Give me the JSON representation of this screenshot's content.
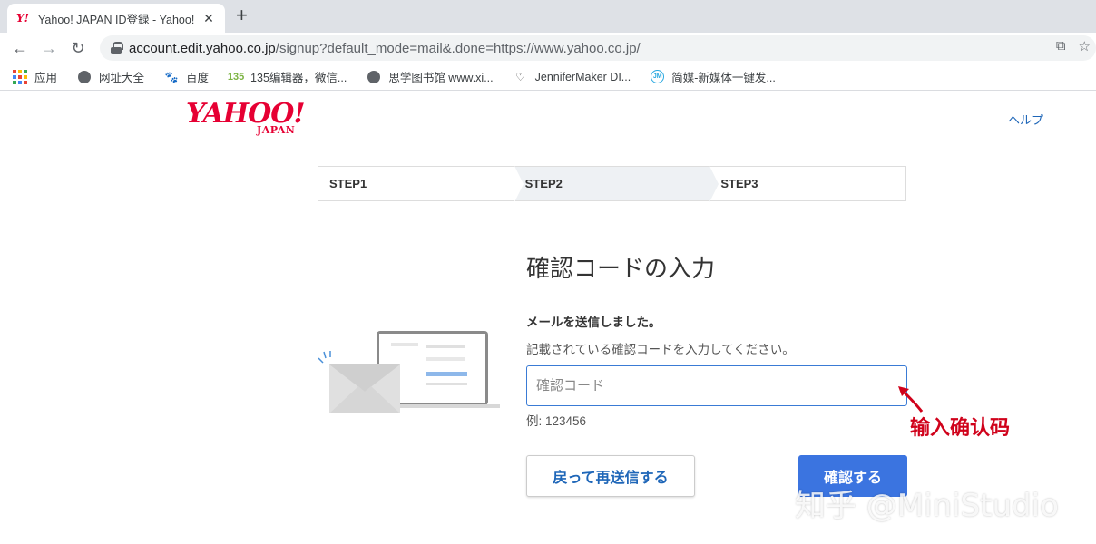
{
  "browser": {
    "tab_title": "Yahoo! JAPAN ID登録 - Yahoo!",
    "favicon_text": "Y!",
    "tab_close": "✕",
    "new_tab": "+",
    "url_host": "account.edit.yahoo.co.jp",
    "url_rest": "/signup?default_mode=mail&.done=https://www.yahoo.co.jp/",
    "nav_icons": [
      "back-icon",
      "forward-icon",
      "reload-icon"
    ],
    "bookmarks": [
      {
        "label": "应用",
        "icon": "apps-icon"
      },
      {
        "label": "网址大全",
        "icon": "globe-icon"
      },
      {
        "label": "百度",
        "icon": "baidu-paw-icon"
      },
      {
        "label": "135编辑器，微信...",
        "icon": "135-editor-icon"
      },
      {
        "label": "思学图书馆 www.xi...",
        "icon": "globe-icon"
      },
      {
        "label": "JenniferMaker DI...",
        "icon": "jennifermaker-icon"
      },
      {
        "label": "简媒-新媒体一键发...",
        "icon": "jianmei-icon"
      }
    ]
  },
  "page": {
    "logo_main": "YAHOO!",
    "logo_sub": "JAPAN",
    "help_link": "ヘルプ",
    "steps": [
      "STEP1",
      "STEP2",
      "STEP3"
    ],
    "active_step": 2,
    "heading": "確認コードの入力",
    "sent_message": "メールを送信しました。",
    "instruction": "記載されている確認コードを入力してください。",
    "code_placeholder": "確認コード",
    "example": "例: 123456",
    "resend_button": "戻って再送信する",
    "confirm_button": "確認する"
  },
  "overlay": {
    "annotation": "输入确认码",
    "watermark": "知乎 @MiniStudio"
  },
  "colors": {
    "brand": "#e60033",
    "link": "#1e66b8",
    "primary_button": "#3b74e0",
    "annotation": "#d0021b"
  }
}
